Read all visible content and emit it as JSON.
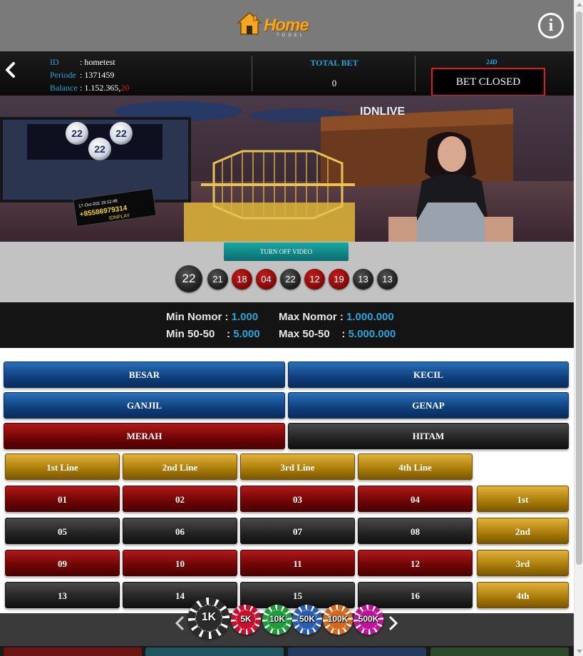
{
  "header": {
    "logo_text": "Home",
    "logo_subtext": "TOGEL",
    "info_icon": "info-icon",
    "info_label": "i"
  },
  "account": {
    "id_label": "ID",
    "id_value": ": hometest",
    "periode_label": "Periode",
    "periode_value": ": 1371459",
    "balance_label": "Balance",
    "balance_value": ": 1.152.365,",
    "balance_cents": "20"
  },
  "total_bet": {
    "label": "TOTAL BET",
    "value": "0"
  },
  "game": {
    "label": "24D",
    "status": "BET CLOSED"
  },
  "video": {
    "toggle_label": "TURN OFF VIDEO",
    "overlay_date": "17-Oct-202  19:12:48",
    "overlay_phone": "+85586979314",
    "overlay_brand": "IDNPLAY",
    "sign_text": "IDNLIVE",
    "ball_label": "22"
  },
  "results": {
    "latest": {
      "value": "22",
      "color": "black"
    },
    "history": [
      {
        "value": "21",
        "color": "black"
      },
      {
        "value": "18",
        "color": "red"
      },
      {
        "value": "04",
        "color": "red"
      },
      {
        "value": "22",
        "color": "black"
      },
      {
        "value": "12",
        "color": "red"
      },
      {
        "value": "19",
        "color": "red"
      },
      {
        "value": "13",
        "color": "black"
      },
      {
        "value": "13",
        "color": "black"
      }
    ]
  },
  "limits": {
    "min_nomor_label": "Min Nomor :",
    "min_nomor_value": "1.000",
    "max_nomor_label": "Max Nomor :",
    "max_nomor_value": "1.000.000",
    "min_5050_label": "Min 50-50    :",
    "min_5050_value": "5.000",
    "max_5050_label": "Max 50-50    :",
    "max_5050_value": "5.000.000"
  },
  "board": {
    "besar": "BESAR",
    "kecil": "KECIL",
    "ganjil": "GANJIL",
    "genap": "GENAP",
    "merah": "MERAH",
    "hitam": "HITAM",
    "lines": [
      "1st Line",
      "2nd Line",
      "3rd Line",
      "4th Line"
    ],
    "rows": [
      "1st",
      "2nd",
      "3rd",
      "4th"
    ],
    "numbers": [
      [
        {
          "value": "01",
          "color": "red"
        },
        {
          "value": "02",
          "color": "red"
        },
        {
          "value": "03",
          "color": "red"
        },
        {
          "value": "04",
          "color": "red"
        }
      ],
      [
        {
          "value": "05",
          "color": "black"
        },
        {
          "value": "06",
          "color": "black"
        },
        {
          "value": "07",
          "color": "black"
        },
        {
          "value": "08",
          "color": "black"
        }
      ],
      [
        {
          "value": "09",
          "color": "red"
        },
        {
          "value": "10",
          "color": "red"
        },
        {
          "value": "11",
          "color": "red"
        },
        {
          "value": "12",
          "color": "red"
        }
      ],
      [
        {
          "value": "13",
          "color": "black"
        },
        {
          "value": "14",
          "color": "black"
        },
        {
          "value": "15",
          "color": "black"
        },
        {
          "value": "16",
          "color": "black"
        }
      ]
    ]
  },
  "chips": [
    {
      "label": "1K",
      "color": "#2b2b2b",
      "selected": true
    },
    {
      "label": "5K",
      "color": "#c8102e",
      "selected": false
    },
    {
      "label": "10K",
      "color": "#1e9c3a",
      "selected": false
    },
    {
      "label": "50K",
      "color": "#2a5db0",
      "selected": false
    },
    {
      "label": "100K",
      "color": "#d2691e",
      "selected": false
    },
    {
      "label": "500K",
      "color": "#c0139a",
      "selected": false
    }
  ],
  "action_colors": [
    "#6b1515",
    "#1f5560",
    "#243a5e",
    "#2c4a2c"
  ],
  "colors": {
    "accent_blue": "#2aa5d8",
    "alert_red": "#e41b1b",
    "header_gray": "#7a7a7a"
  }
}
